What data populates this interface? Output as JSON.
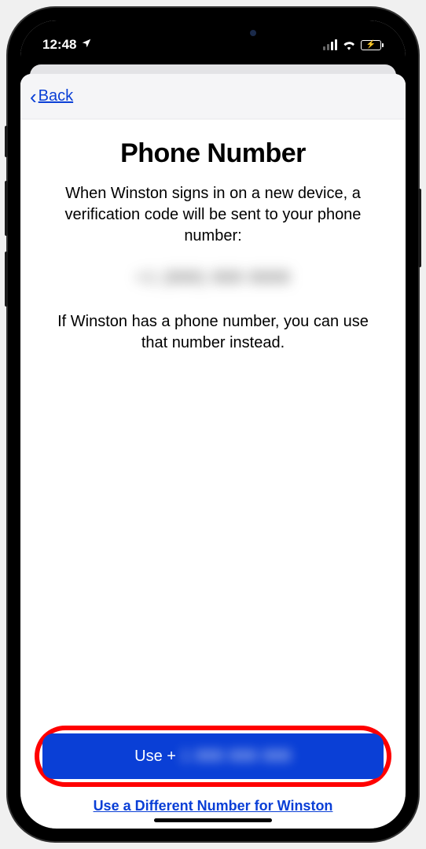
{
  "status": {
    "time": "12:48",
    "location_arrow": "➤"
  },
  "nav": {
    "back_label": "Back"
  },
  "page": {
    "title": "Phone Number",
    "description": "When Winston signs in on a new device, a verification code will be sent to your phone number:",
    "phone_redacted": "+1 (888) 888 8888",
    "description2": "If Winston has a phone number, you can use that number instead."
  },
  "actions": {
    "primary_prefix": "Use +",
    "primary_redacted": "1 888 888 888",
    "alt_label": "Use a Different Number for Winston"
  }
}
